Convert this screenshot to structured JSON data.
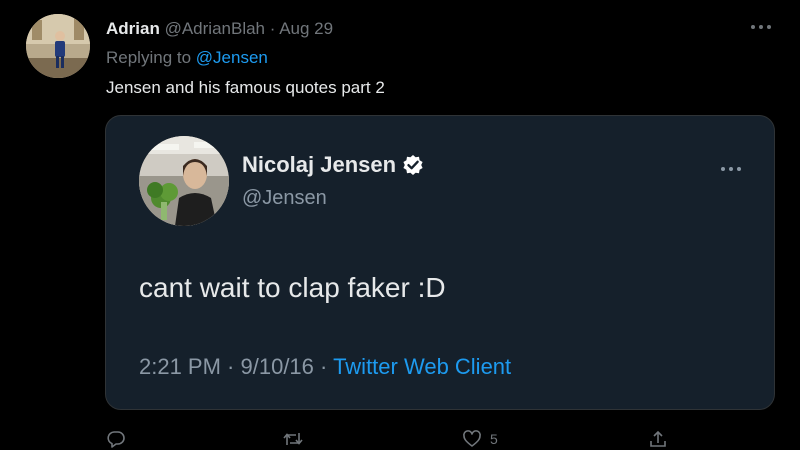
{
  "tweet": {
    "author_name": "Adrian",
    "author_handle": "@AdrianBlah",
    "separator": " · ",
    "date": "Aug 29",
    "replying_prefix": "Replying to ",
    "replying_to": "@Jensen",
    "text": "Jensen and his famous quotes part 2",
    "more_icon": "more-icon"
  },
  "quote": {
    "author_name": "Nicolaj Jensen",
    "author_handle": "@Jensen",
    "verified_icon": "verified-badge-icon",
    "text": "cant wait to clap faker :D",
    "time": "2:21 PM",
    "separator1": " · ",
    "date": "9/10/16",
    "separator2": " · ",
    "client": "Twitter Web Client"
  },
  "actions": {
    "reply_icon": "reply-icon",
    "retweet_icon": "retweet-icon",
    "like_icon": "like-icon",
    "like_count": "5",
    "share_icon": "share-icon"
  },
  "colors": {
    "background": "#000000",
    "card_background": "#15202b",
    "accent": "#1d9bf0",
    "muted": "#71767b"
  }
}
